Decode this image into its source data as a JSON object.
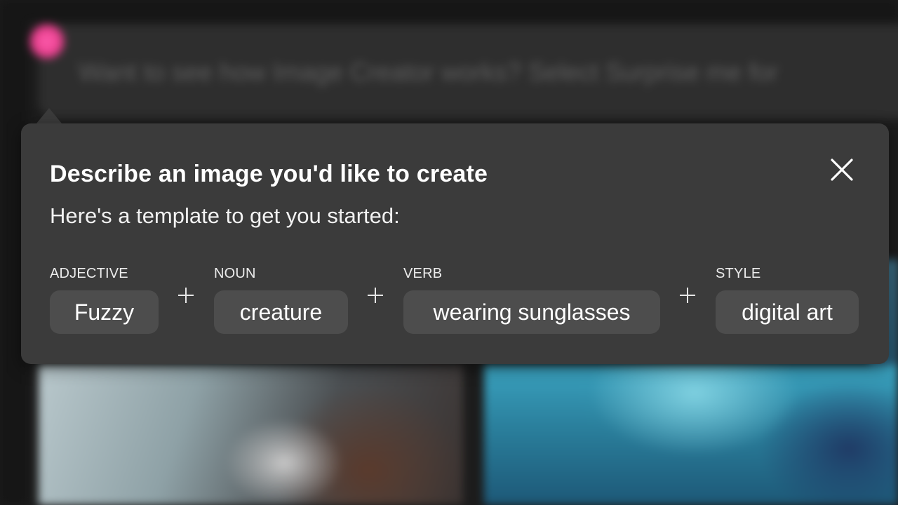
{
  "background": {
    "prompt_placeholder": "Want to see how Image Creator works? Select Surprise me for"
  },
  "popover": {
    "title": "Describe an image you'd like to create",
    "subtitle": "Here's a template to get you started:",
    "close_icon": "close-icon",
    "template": [
      {
        "label": "ADJECTIVE",
        "value": "Fuzzy"
      },
      {
        "label": "NOUN",
        "value": "creature"
      },
      {
        "label": "VERB",
        "value": "wearing sunglasses"
      },
      {
        "label": "STYLE",
        "value": "digital art"
      }
    ],
    "separator_icon": "plus-icon"
  },
  "colors": {
    "popover_bg": "#3b3b3b",
    "chip_bg": "#4d4d4d",
    "page_bg": "#1c1c1c",
    "avatar_accent": "#e83e8c"
  }
}
